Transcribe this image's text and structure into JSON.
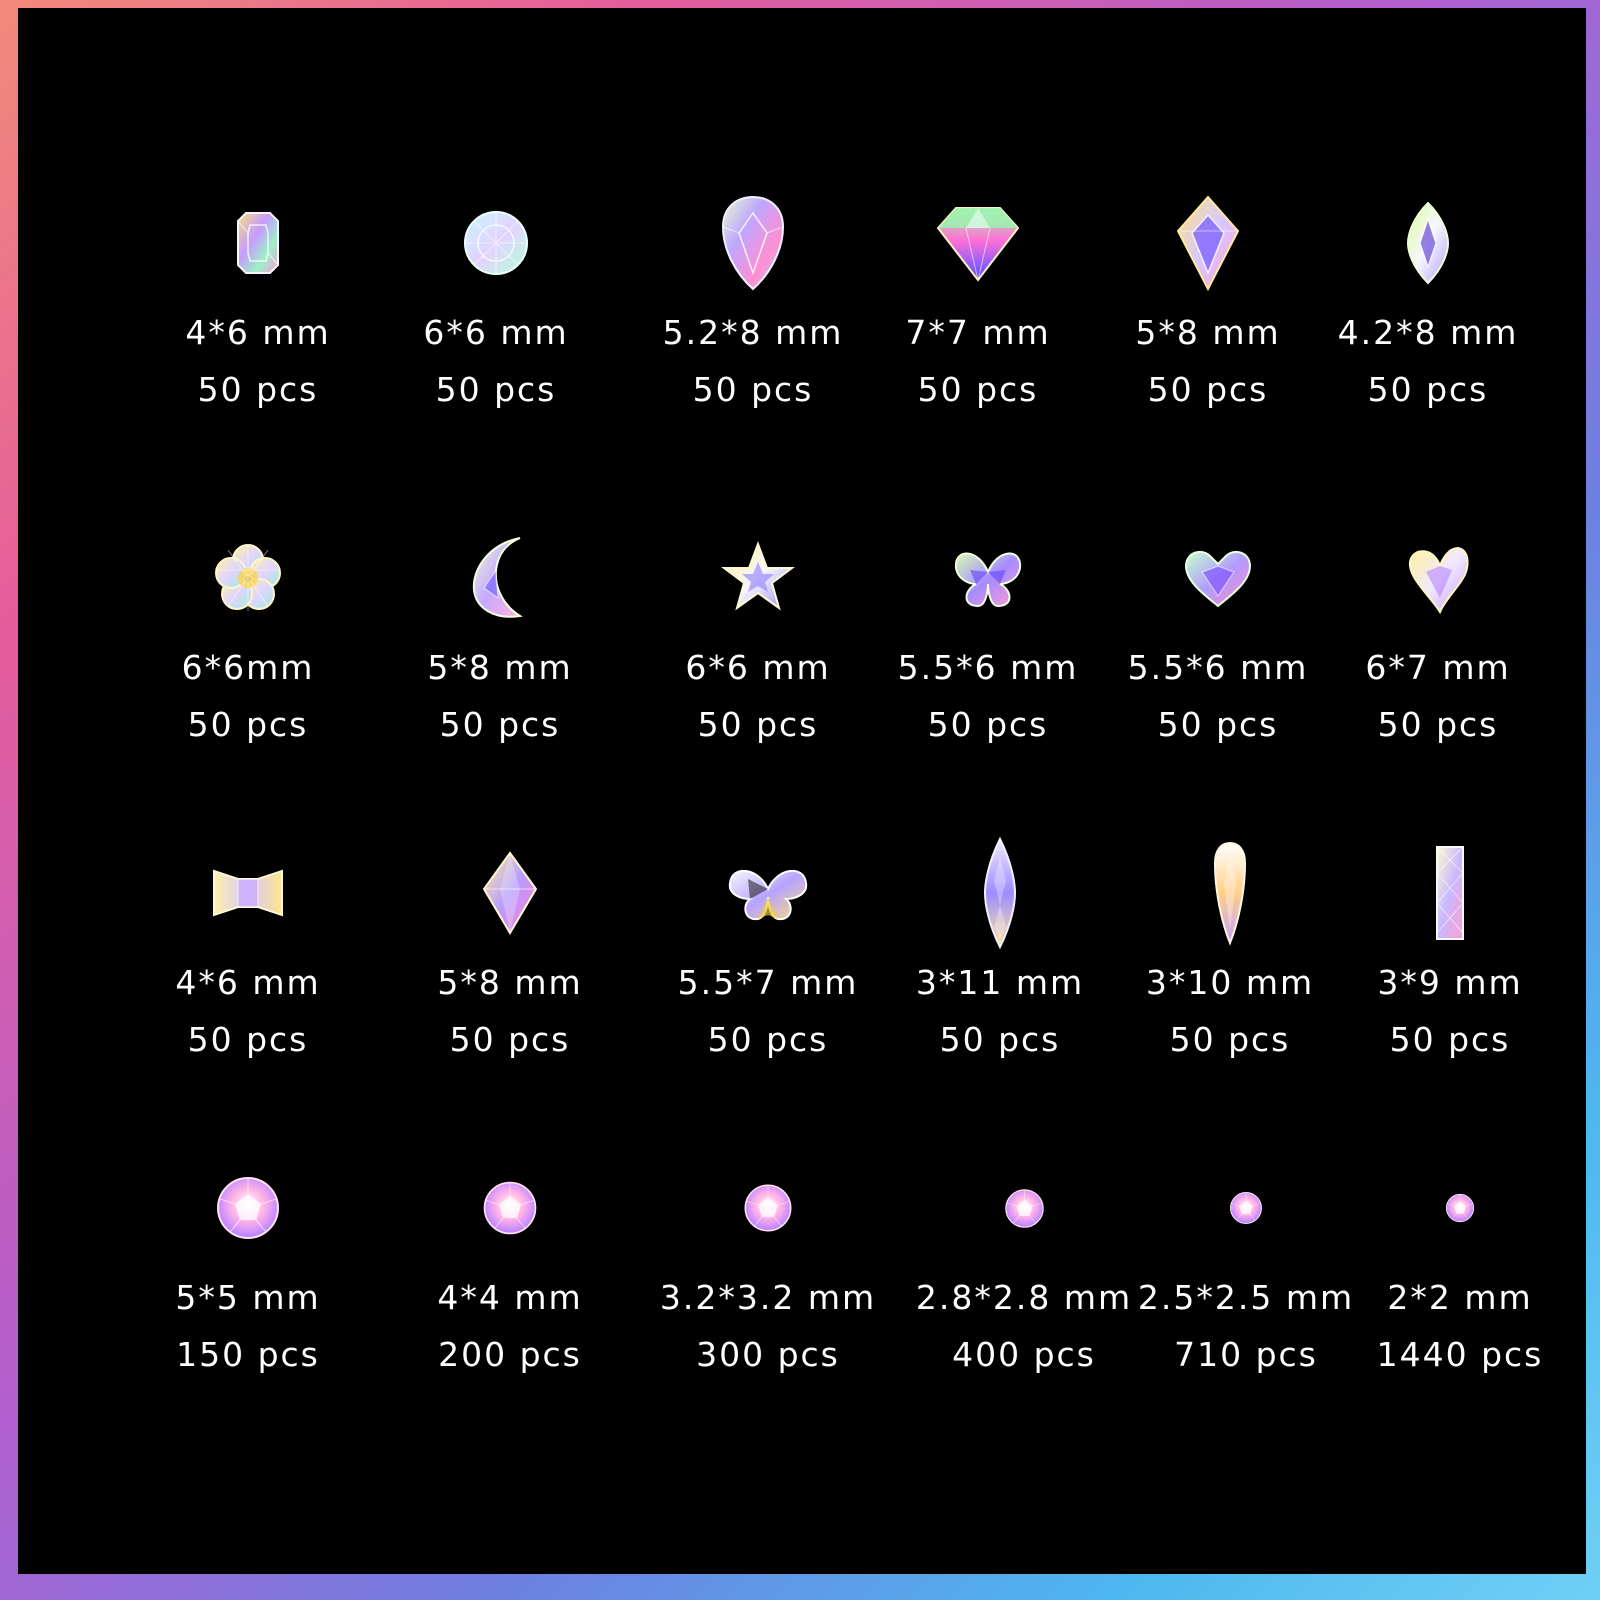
{
  "colors": {
    "frame_gradient": [
      "#f28a7a",
      "#e45d9c",
      "#b05fd0",
      "#6e7fe0",
      "#4db8ef",
      "#6fd0f5"
    ],
    "panel_background": "#000000",
    "text": "#ffffff"
  },
  "rows": [
    [
      {
        "shape": "rectangle-octagon",
        "size": "4*6 mm",
        "qty": "50 pcs"
      },
      {
        "shape": "round-faceted",
        "size": "6*6 mm",
        "qty": "50 pcs"
      },
      {
        "shape": "teardrop",
        "size": "5.2*8 mm",
        "qty": "50 pcs"
      },
      {
        "shape": "diamond",
        "size": "7*7 mm",
        "qty": "50 pcs"
      },
      {
        "shape": "kite",
        "size": "5*8 mm",
        "qty": "50 pcs"
      },
      {
        "shape": "marquise",
        "size": "4.2*8 mm",
        "qty": "50 pcs"
      }
    ],
    [
      {
        "shape": "flower",
        "size": "6*6mm",
        "qty": "50 pcs"
      },
      {
        "shape": "moon",
        "size": "5*8 mm",
        "qty": "50 pcs"
      },
      {
        "shape": "star",
        "size": "6*6 mm",
        "qty": "50 pcs"
      },
      {
        "shape": "butterfly",
        "size": "5.5*6 mm",
        "qty": "50 pcs"
      },
      {
        "shape": "heart",
        "size": "5.5*6 mm",
        "qty": "50 pcs"
      },
      {
        "shape": "heart-tilted",
        "size": "6*7 mm",
        "qty": "50 pcs"
      }
    ],
    [
      {
        "shape": "bowtie",
        "size": "4*6 mm",
        "qty": "50 pcs"
      },
      {
        "shape": "rhombus",
        "size": "5*8 mm",
        "qty": "50 pcs"
      },
      {
        "shape": "butterfly-wide",
        "size": "5.5*7 mm",
        "qty": "50 pcs"
      },
      {
        "shape": "navette-long",
        "size": "3*11 mm",
        "qty": "50 pcs"
      },
      {
        "shape": "drop-long",
        "size": "3*10 mm",
        "qty": "50 pcs"
      },
      {
        "shape": "baguette",
        "size": "3*9 mm",
        "qty": "50 pcs"
      }
    ],
    [
      {
        "shape": "round-rhinestone",
        "gem_scale": 1.0,
        "size": "5*5 mm",
        "qty": "150 pcs"
      },
      {
        "shape": "round-rhinestone",
        "gem_scale": 0.85,
        "size": "4*4 mm",
        "qty": "200 pcs"
      },
      {
        "shape": "round-rhinestone",
        "gem_scale": 0.75,
        "size": "3.2*3.2 mm",
        "qty": "300 pcs"
      },
      {
        "shape": "round-rhinestone",
        "gem_scale": 0.62,
        "size": "2.8*2.8 mm",
        "qty": "400 pcs"
      },
      {
        "shape": "round-rhinestone",
        "gem_scale": 0.52,
        "size": "2.5*2.5 mm",
        "qty": "710 pcs"
      },
      {
        "shape": "round-rhinestone",
        "gem_scale": 0.45,
        "size": "2*2 mm",
        "qty": "1440 pcs"
      }
    ]
  ]
}
